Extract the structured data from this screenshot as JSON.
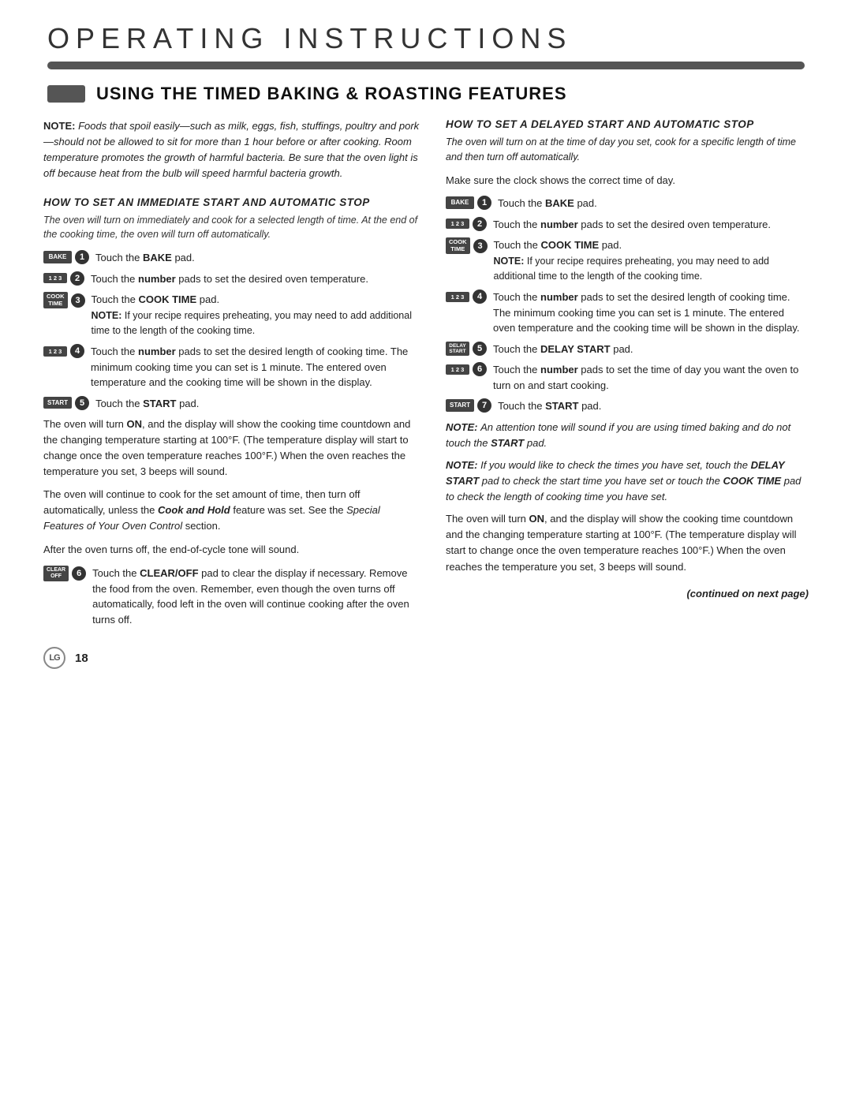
{
  "header": {
    "title": "Operating Instructions",
    "section_title": "Using the Timed Baking & Roasting Features"
  },
  "left_column": {
    "note_label": "NOTE:",
    "note_text": "Foods that spoil easily—such as milk, eggs, fish, stuffings, poultry and pork—should not be allowed to sit for more than 1 hour before or after cooking. Room temperature promotes the growth of harmful bacteria. Be sure that the oven light is off because heat from the bulb will speed harmful bacteria growth.",
    "immediate_start_heading": "How to Set an Immediate Start and Automatic Stop",
    "immediate_start_sub": "The oven will turn on immediately and cook for a selected length of time. At the end of the cooking time, the oven will turn off automatically.",
    "steps": [
      {
        "num": "1",
        "key": "BAKE",
        "key_type": "bake",
        "text": "Touch the ",
        "bold": "BAKE",
        "text2": " pad."
      },
      {
        "num": "2",
        "key": "1 2 3",
        "key_type": "numbers",
        "text": "Touch the ",
        "bold": "number",
        "text2": " pads to set the desired oven temperature."
      },
      {
        "num": "3",
        "key": "COOK TIME",
        "key_type": "cook-time",
        "text": "Touch the ",
        "bold": "COOK TIME",
        "text2": " pad."
      }
    ],
    "step3_note": "NOTE: If your recipe requires preheating, you may need to add additional time to the length of the cooking time.",
    "step4": {
      "num": "4",
      "key": "1 2 3",
      "key_type": "numbers",
      "text": "Touch the ",
      "bold": "number",
      "text2": " pads to set the desired length of cooking time. The minimum cooking time you can set is 1 minute. The entered oven temperature and the cooking time will be shown in the display."
    },
    "step5": {
      "num": "5",
      "key": "START",
      "key_type": "start",
      "text": "Touch the ",
      "bold": "START",
      "text2": " pad."
    },
    "body_paragraphs": [
      "The oven will turn ON, and the display will show the cooking time countdown and the changing temperature starting at 100°F. (The temperature display will start to change once the oven temperature reaches 100°F.) When the oven reaches the temperature you set, 3 beeps will sound.",
      "The oven will continue to cook for the set amount of time, then turn off automatically, unless the Cook and Hold feature was set. See the Special Features of Your Oven Control section.",
      "After the oven turns off, the end-of-cycle tone will sound."
    ],
    "step6": {
      "num": "6",
      "key": "CLEAR OFF",
      "key_type": "clear-off",
      "text": "Touch the ",
      "bold": "CLEAR/OFF",
      "text2": " pad to clear the display if necessary. Remove the food from the oven. Remember, even though the oven turns off automatically, food left in the oven will continue cooking after the oven turns off."
    }
  },
  "right_column": {
    "heading": "How to Set a Delayed Start and Automatic Stop",
    "intro": "The oven will turn on at the time of day you set, cook for a specific length of time and then turn off automatically.",
    "make_sure": "Make sure the clock shows the correct time of day.",
    "steps": [
      {
        "num": "1",
        "key": "BAKE",
        "key_type": "bake",
        "text": "Touch the ",
        "bold": "BAKE",
        "text2": " pad."
      },
      {
        "num": "2",
        "key": "1 2 3",
        "key_type": "numbers",
        "text": "Touch the ",
        "bold": "number",
        "text2": " pads to set the desired oven temperature."
      },
      {
        "num": "3",
        "key": "COOK TIME",
        "key_type": "cook-time",
        "text": "Touch the ",
        "bold": "COOK TIME",
        "text2": " pad."
      }
    ],
    "step3_note": "NOTE: If your recipe requires preheating, you may need to add additional time to the length of the cooking time.",
    "step4": {
      "num": "4",
      "key": "1 2 3",
      "key_type": "numbers",
      "text": "Touch the ",
      "bold": "number",
      "text2": " pads to set the desired length of cooking time. The minimum cooking time you can set is 1 minute. The entered oven temperature and the cooking time will be shown in the display."
    },
    "step5": {
      "num": "5",
      "key": "DELAY START",
      "key_type": "delay-start",
      "text": "Touch the ",
      "bold": "DELAY START",
      "text2": " pad."
    },
    "step6": {
      "num": "6",
      "key": "1 2 3",
      "key_type": "numbers",
      "text": "Touch the ",
      "bold": "number",
      "text2": " pads to set the time of day you want the oven to turn on and start cooking."
    },
    "step7": {
      "num": "7",
      "key": "START",
      "key_type": "start",
      "text": "Touch the ",
      "bold": "START",
      "text2": " pad."
    },
    "notes": [
      {
        "label": "NOTE:",
        "text": "An attention tone will sound if you are using timed baking and do not touch the START pad.",
        "italic": true
      },
      {
        "label": "NOTE:",
        "text": "If you would like to check the times you have set, touch the DELAY START pad to check the start time you have set or touch the COOK TIME pad to check the length of cooking time you have set.",
        "italic": true
      }
    ],
    "body_paragraph": "The oven will turn ON, and the display will show the cooking time countdown and the changing temperature starting at 100°F. (The temperature display will start to change once the oven temperature reaches 100°F.) When the oven reaches the temperature you set, 3 beeps will sound.",
    "continued": "(continued on next page)"
  },
  "footer": {
    "logo": "LG",
    "page_number": "18"
  }
}
